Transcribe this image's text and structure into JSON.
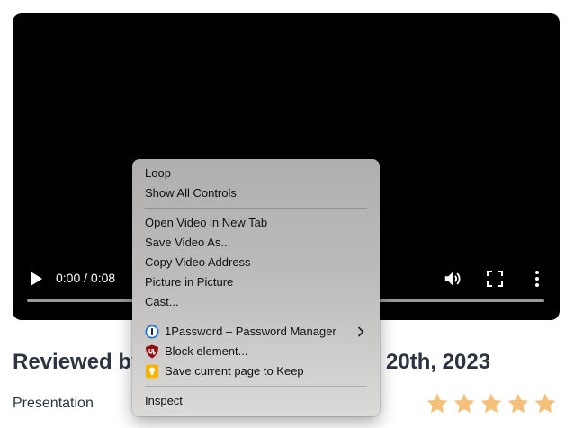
{
  "video": {
    "time": "0:00 / 0:08",
    "progress": 0,
    "icons": {
      "play": "play-icon",
      "volume": "volume-icon",
      "fullscreen": "fullscreen-icon",
      "more": "more-vertical-icon"
    }
  },
  "review": {
    "title": "Reviewed by",
    "date": "20th, 2023",
    "category": "Presentation",
    "rating": 5,
    "rating_max": 5,
    "star_color": "#f5c07a"
  },
  "menu": {
    "loop": "Loop",
    "show_all_controls": "Show All Controls",
    "open_video_new_tab": "Open Video in New Tab",
    "save_video_as": "Save Video As...",
    "copy_video_address": "Copy Video Address",
    "picture_in_picture": "Picture in Picture",
    "cast": "Cast...",
    "onepassword": "1Password – Password Manager",
    "block_element": "Block element...",
    "save_to_keep": "Save current page to Keep",
    "inspect": "Inspect",
    "icons": {
      "onepassword": "onepassword-icon",
      "ublock": "ublock-shield-icon",
      "keep": "google-keep-icon",
      "submenu": "chevron-right-icon"
    }
  }
}
